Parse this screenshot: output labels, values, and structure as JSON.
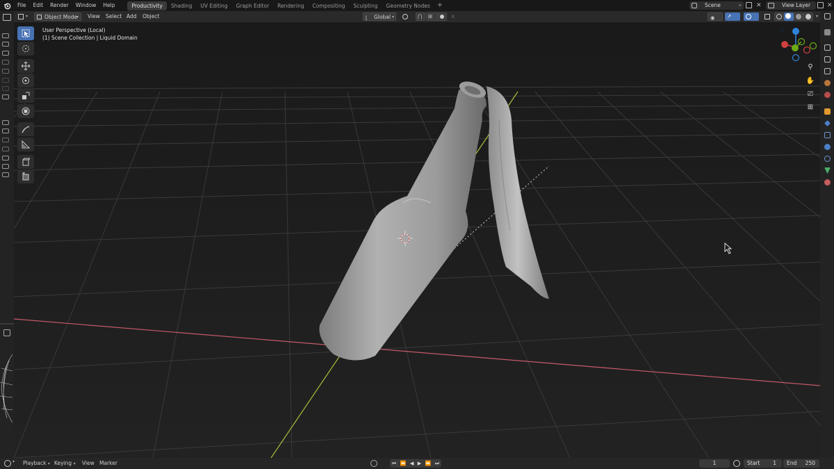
{
  "menu": {
    "file": "File",
    "edit": "Edit",
    "render": "Render",
    "window": "Window",
    "help": "Help"
  },
  "workspaces": [
    {
      "label": "Productivity"
    },
    {
      "label": "Shading"
    },
    {
      "label": "UV Editing"
    },
    {
      "label": "Graph Editor"
    },
    {
      "label": "Rendering"
    },
    {
      "label": "Compositing"
    },
    {
      "label": "Sculpting"
    },
    {
      "label": "Geometry Nodes"
    }
  ],
  "top_right": {
    "scene": "Scene",
    "view_layer": "View Layer"
  },
  "header": {
    "mode": "Object Mode",
    "view": "View",
    "select": "Select",
    "add": "Add",
    "object": "Object",
    "orientation": "Global"
  },
  "viewport": {
    "perspective": "User Perspective (Local)",
    "collection": "(1) Scene Collection | Liquid Domain"
  },
  "gizmo": {
    "x": "X",
    "y": "Y",
    "z": "Z"
  },
  "timeline": {
    "playback": "Playback",
    "keying": "Keying",
    "view": "View",
    "marker": "Marker",
    "current_frame": "1",
    "start_label": "Start",
    "start": "1",
    "end_label": "End",
    "end": "250"
  },
  "colors": {
    "accent": "#4772b3",
    "axis_x": "#c85a6a",
    "axis_y": "#a6c23a",
    "gizmo_x": "#d2413f",
    "gizmo_y": "#6cab16",
    "gizmo_z": "#2f84d9"
  }
}
